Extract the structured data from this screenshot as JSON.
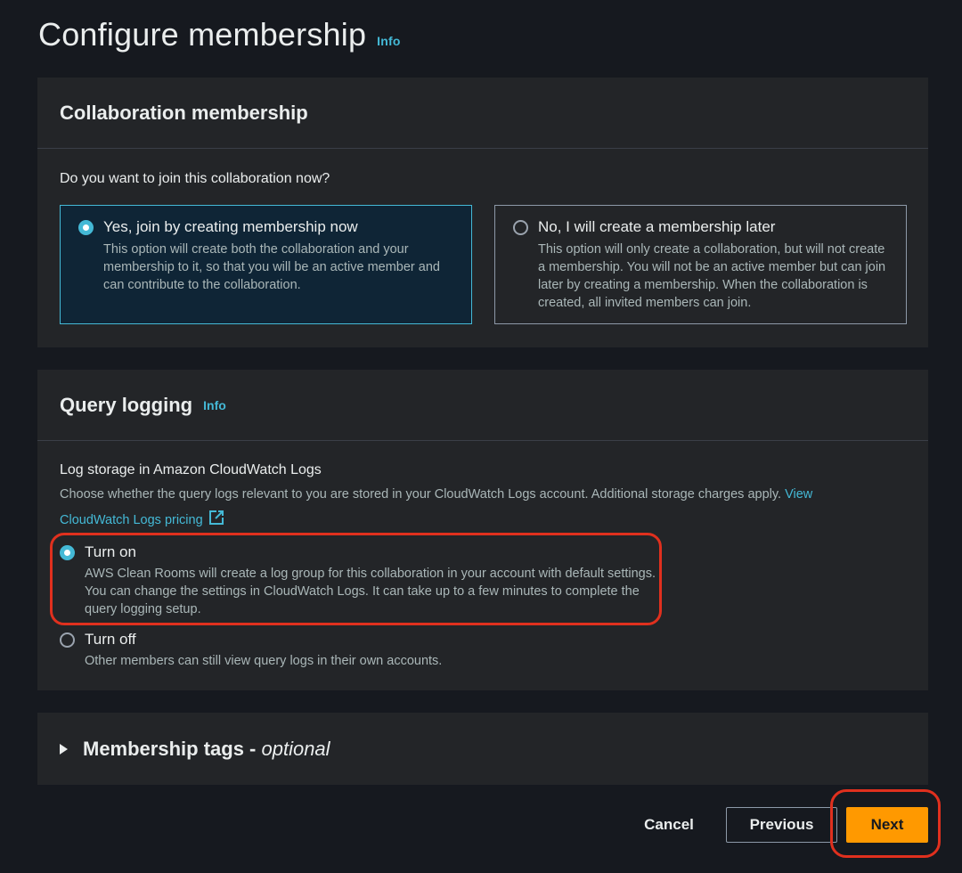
{
  "page": {
    "title": "Configure membership",
    "info_label": "Info"
  },
  "collaboration": {
    "title": "Collaboration membership",
    "question": "Do you want to join this collaboration now?",
    "options": [
      {
        "title": "Yes, join by creating membership now",
        "description": "This option will create both the collaboration and your membership to it, so that you will be an active member and can contribute to the collaboration.",
        "selected": true
      },
      {
        "title": "No, I will create a membership later",
        "description": "This option will only create a collaboration, but will not create a membership. You will not be an active member but can join later by creating a membership. When the collaboration is created, all invited members can join.",
        "selected": false
      }
    ]
  },
  "query_logging": {
    "title": "Query logging",
    "info_label": "Info",
    "field_label": "Log storage in Amazon CloudWatch Logs",
    "description": "Choose whether the query logs relevant to you are stored in your CloudWatch Logs account. Additional storage charges apply.",
    "link_text_1": "View",
    "link_text_2": "CloudWatch Logs pricing",
    "link_icon": "external-link-icon",
    "options": [
      {
        "title": "Turn on",
        "description": "AWS Clean Rooms will create a log group for this collaboration in your account with default settings. You can change the settings in CloudWatch Logs. It can take up to a few minutes to complete the query logging setup.",
        "selected": true
      },
      {
        "title": "Turn off",
        "description": "Other members can still view query logs in their own accounts.",
        "selected": false
      }
    ]
  },
  "tags": {
    "title": "Membership tags - ",
    "optional": "optional",
    "icon": "caret-right-icon"
  },
  "footer": {
    "cancel": "Cancel",
    "previous": "Previous",
    "next": "Next"
  },
  "colors": {
    "accent": "#44b9d6",
    "primary_button": "#ff9900",
    "highlight": "#e0301e"
  }
}
